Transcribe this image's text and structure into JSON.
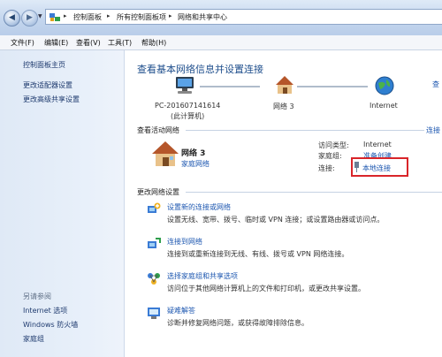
{
  "address": {
    "crumbs": [
      "控制面板",
      "所有控制面板项",
      "网络和共享中心"
    ]
  },
  "menu": [
    "文件(F)",
    "编辑(E)",
    "查看(V)",
    "工具(T)",
    "帮助(H)"
  ],
  "sidebar": {
    "home": "控制面板主页",
    "links": [
      "更改适配器设置",
      "更改高级共享设置"
    ],
    "see_also_title": "另请参阅",
    "see_also": [
      "Internet 选项",
      "Windows 防火墙",
      "家庭组"
    ]
  },
  "main": {
    "title": "查看基本网络信息并设置连接",
    "map": {
      "computer_name": "PC-201607141614",
      "computer_sub": "(此计算机)",
      "network": "网络  3",
      "internet": "Internet",
      "right_cut": "查"
    },
    "active_title": "查看活动网络",
    "active_right_cut": "连接",
    "network_name": "网络  3",
    "network_type": "家庭网络",
    "props": {
      "access_label": "访问类型:",
      "access_value": "Internet",
      "homegroup_label": "家庭组:",
      "homegroup_value": "准备创建",
      "conn_label": "连接:",
      "conn_value": "本地连接"
    },
    "change_title": "更改网络设置",
    "tasks": [
      {
        "title": "设置新的连接或网络",
        "desc": "设置无线、宽带、拨号、临时或 VPN 连接；或设置路由器或访问点。"
      },
      {
        "title": "连接到网络",
        "desc": "连接到或重新连接到无线、有线、拨号或 VPN 网络连接。"
      },
      {
        "title": "选择家庭组和共享选项",
        "desc": "访问位于其他网络计算机上的文件和打印机，或更改共享设置。"
      },
      {
        "title": "疑难解答",
        "desc": "诊断并修复网络问题，或获得故障排除信息。"
      }
    ]
  },
  "colors": {
    "link": "#1d57b0",
    "title": "#1e4e8c",
    "highlight_box": "#d9252a"
  }
}
